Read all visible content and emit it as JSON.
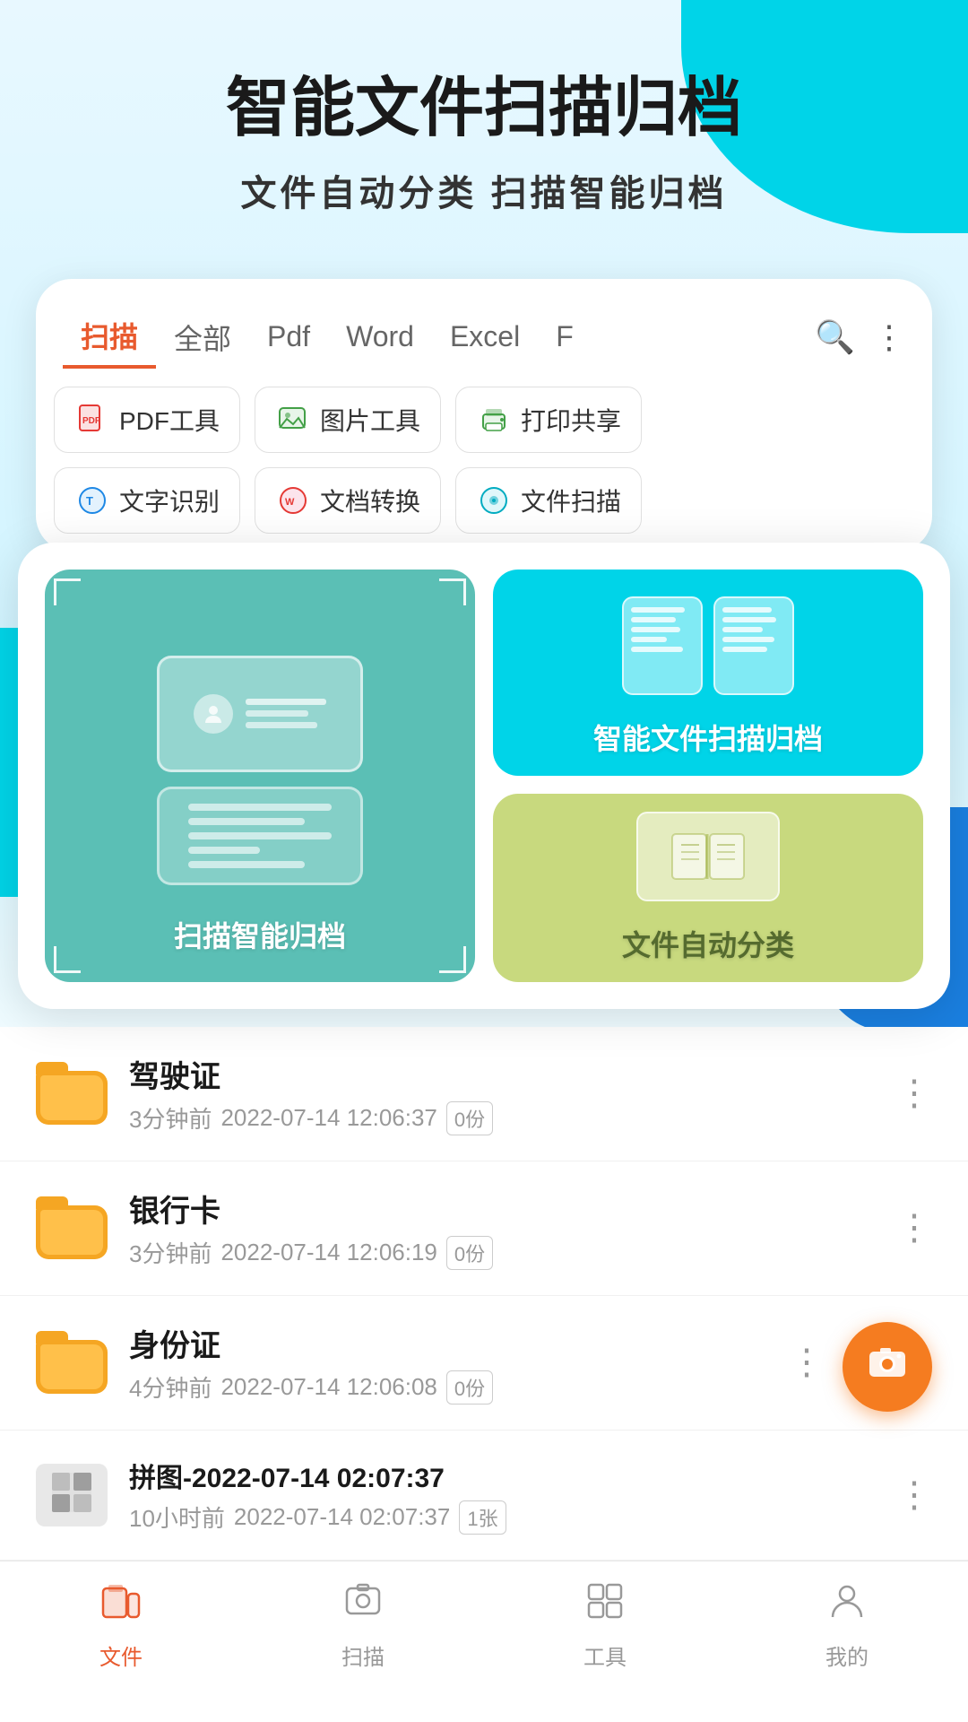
{
  "hero": {
    "title": "智能文件扫描归档",
    "subtitle": "文件自动分类   扫描智能归档"
  },
  "tabs": {
    "items": [
      {
        "label": "扫描",
        "active": true
      },
      {
        "label": "全部",
        "active": false
      },
      {
        "label": "Pdf",
        "active": false
      },
      {
        "label": "Word",
        "active": false
      },
      {
        "label": "Excel",
        "active": false
      },
      {
        "label": "F",
        "active": false
      }
    ]
  },
  "tools": {
    "row1": [
      {
        "label": "PDF工具",
        "icon": "pdf"
      },
      {
        "label": "图片工具",
        "icon": "image"
      },
      {
        "label": "打印共享",
        "icon": "print"
      }
    ],
    "row2": [
      {
        "label": "文字识别",
        "icon": "text"
      },
      {
        "label": "文档转换",
        "icon": "convert"
      },
      {
        "label": "文件扫描",
        "icon": "scan"
      }
    ]
  },
  "features": {
    "scan_label": "扫描智能归档",
    "smart_label": "智能文件扫描归档",
    "classify_label": "文件自动分类"
  },
  "files": [
    {
      "name": "驾驶证",
      "time": "3分钟前",
      "date": "2022-07-14 12:06:37",
      "count": "0份",
      "type": "folder"
    },
    {
      "name": "银行卡",
      "time": "3分钟前",
      "date": "2022-07-14 12:06:19",
      "count": "0份",
      "type": "folder"
    },
    {
      "name": "身份证",
      "time": "4分钟前",
      "date": "2022-07-14 12:06:08",
      "count": "0份",
      "type": "folder"
    },
    {
      "name": "拼图-2022-07-14 02:07:37",
      "time": "10小时前",
      "date": "2022-07-14 02:07:37",
      "count": "1张",
      "type": "image"
    }
  ],
  "bottom_nav": [
    {
      "label": "文件",
      "active": true,
      "icon": "folder"
    },
    {
      "label": "扫描",
      "active": false,
      "icon": "camera"
    },
    {
      "label": "工具",
      "active": false,
      "icon": "grid"
    },
    {
      "label": "我的",
      "active": false,
      "icon": "person"
    }
  ]
}
